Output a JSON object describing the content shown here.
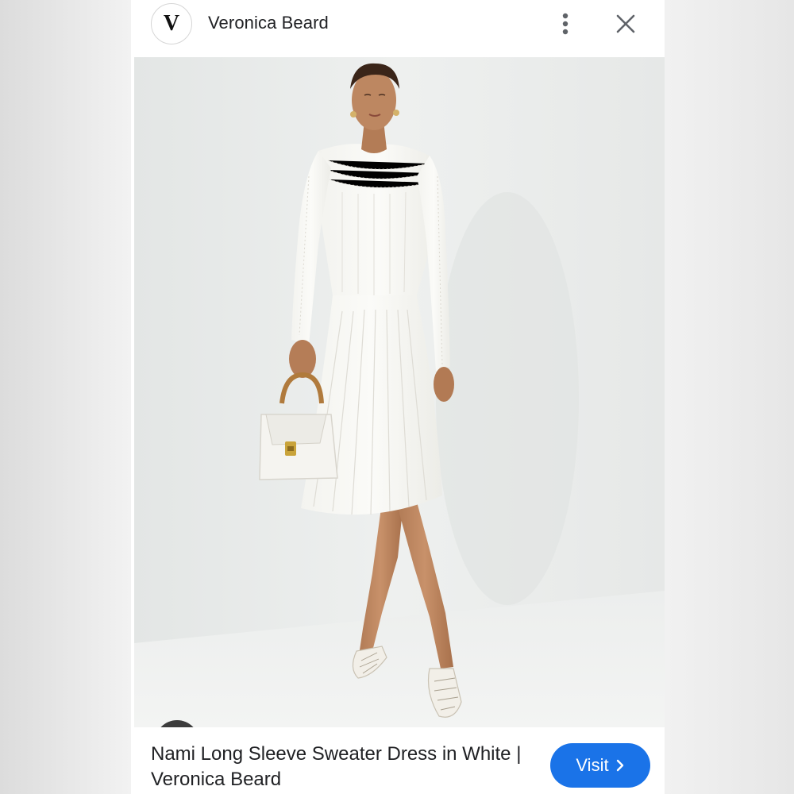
{
  "header": {
    "favicon_letter": "V",
    "source_name": "Veronica Beard"
  },
  "icons": {
    "more": "more-vert-icon",
    "close": "close-icon",
    "lens": "google-lens-icon",
    "visit_chevron": "chevron-right-icon"
  },
  "image": {
    "alt": "Model in white long sleeve sweater dress holding a white handbag"
  },
  "result": {
    "title": "Nami Long Sleeve Sweater Dress in White | Veronica Beard",
    "visit_label": "Visit"
  },
  "colors": {
    "accent": "#1a73e8",
    "lens_button": "#3c3c3c",
    "image_background": "#e9ebea"
  }
}
